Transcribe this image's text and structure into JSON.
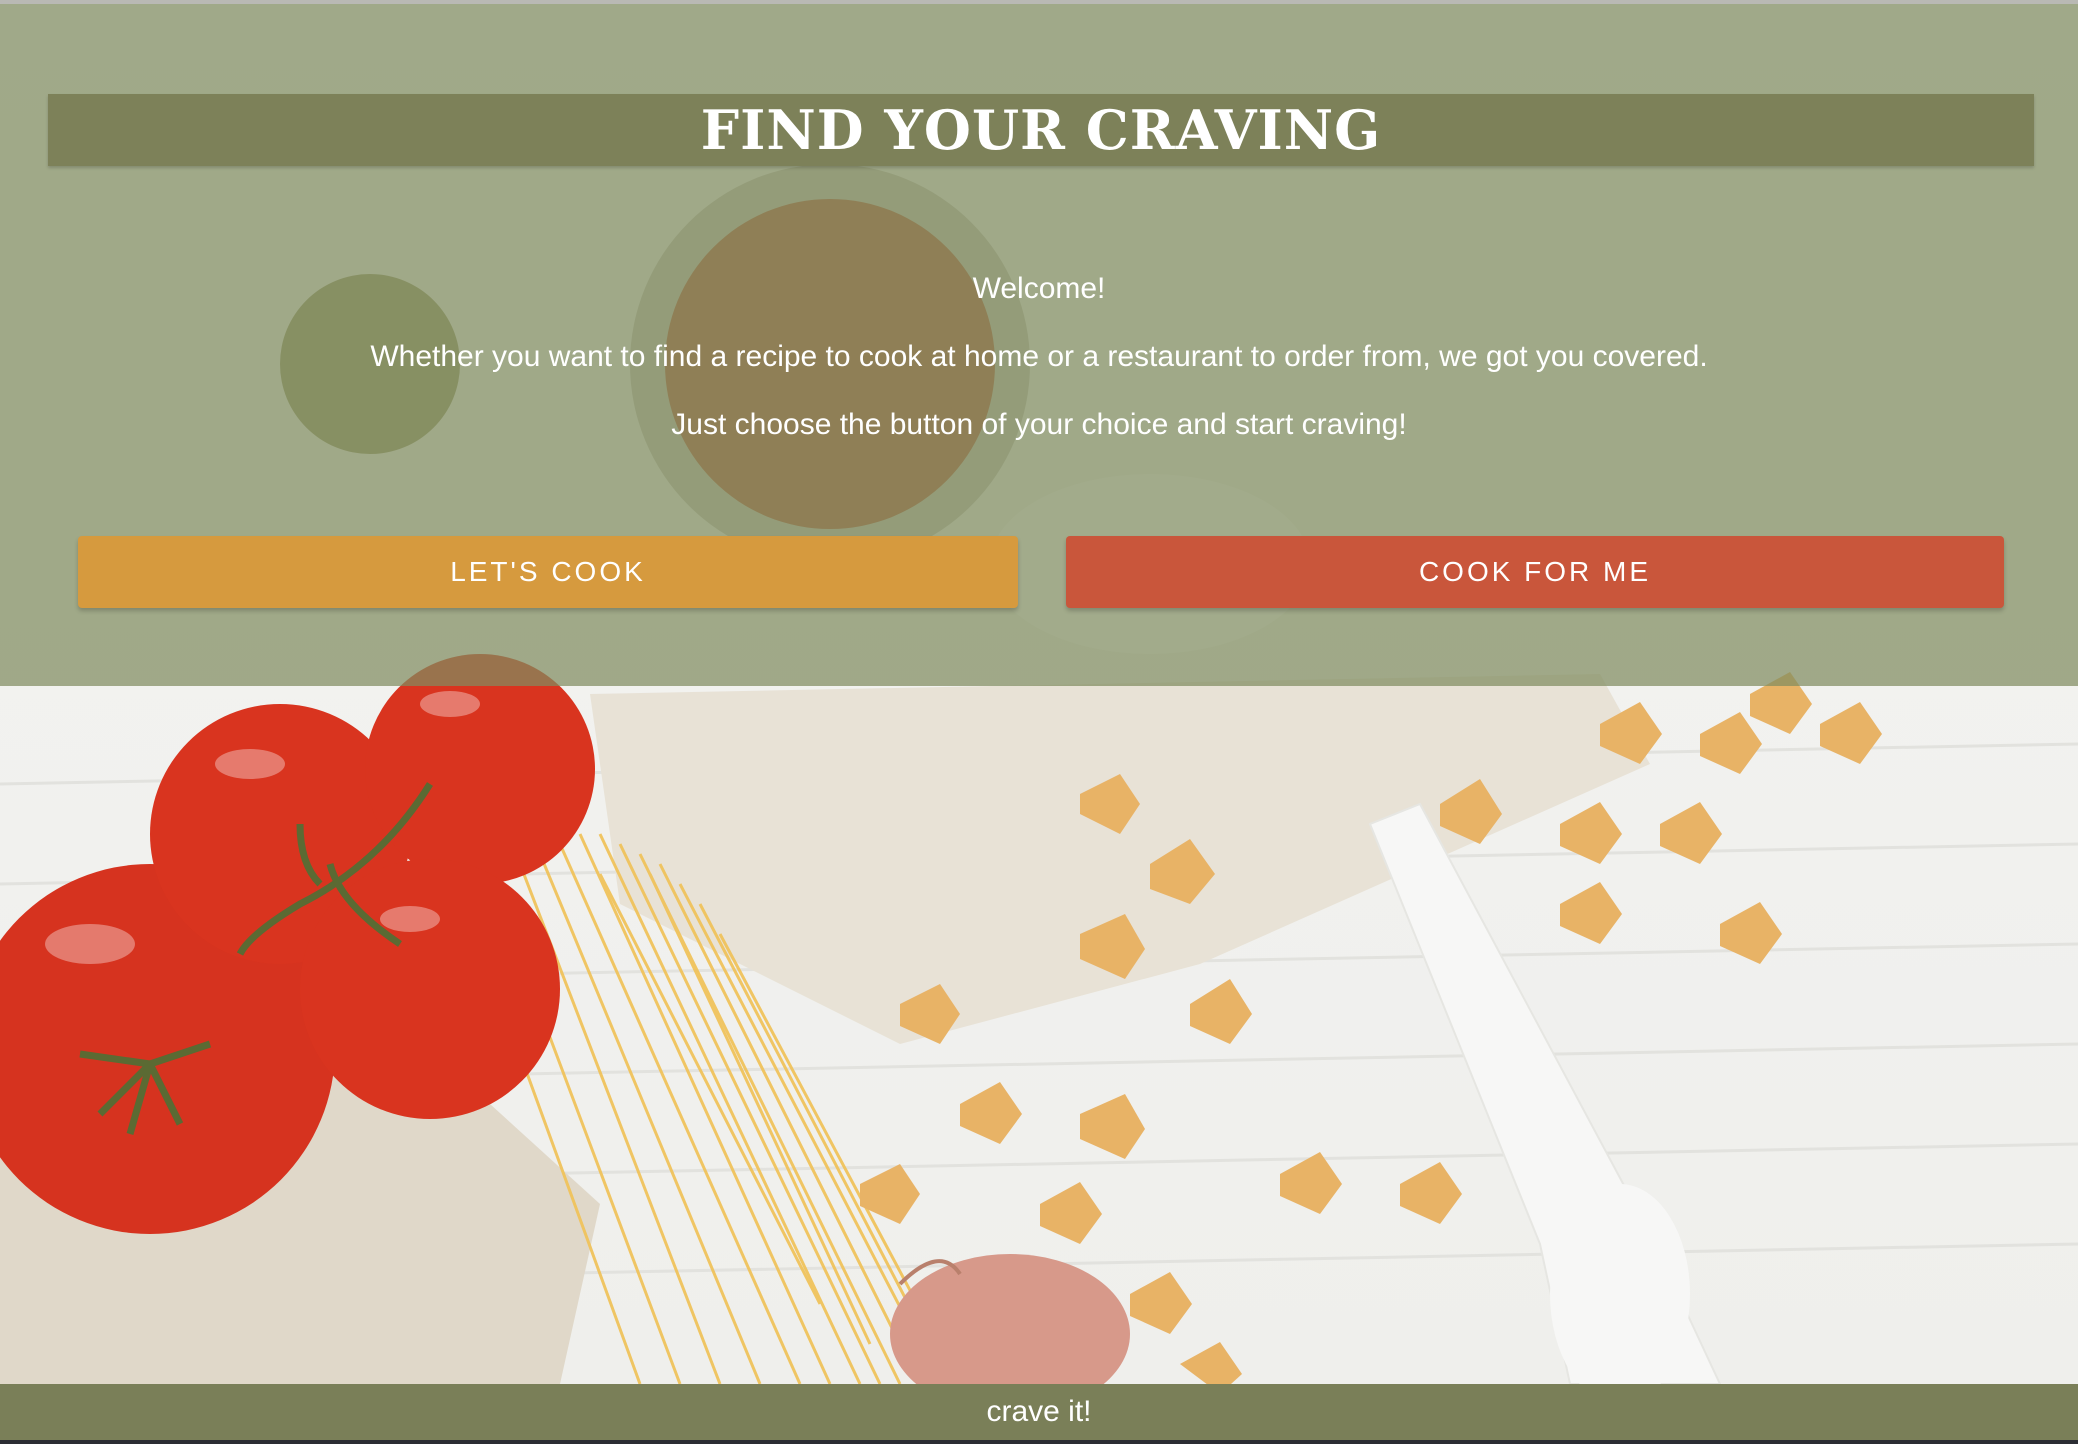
{
  "hero": {
    "title": "FIND YOUR CRAVING",
    "welcome": "Welcome!",
    "description": "Whether you want to find a recipe to cook at home or a restaurant to order from, we got you covered.",
    "call_to_action": "Just choose the button of your choice and start craving!"
  },
  "buttons": {
    "cook_label": "LET'S COOK",
    "order_label": "COOK FOR ME"
  },
  "footer": {
    "tagline": "crave it!"
  },
  "colors": {
    "overlay": "#808c60",
    "title_bar": "#7d8159",
    "cook_button": "#d69a3e",
    "order_button": "#c9563b",
    "footer": "#7a7f58"
  }
}
